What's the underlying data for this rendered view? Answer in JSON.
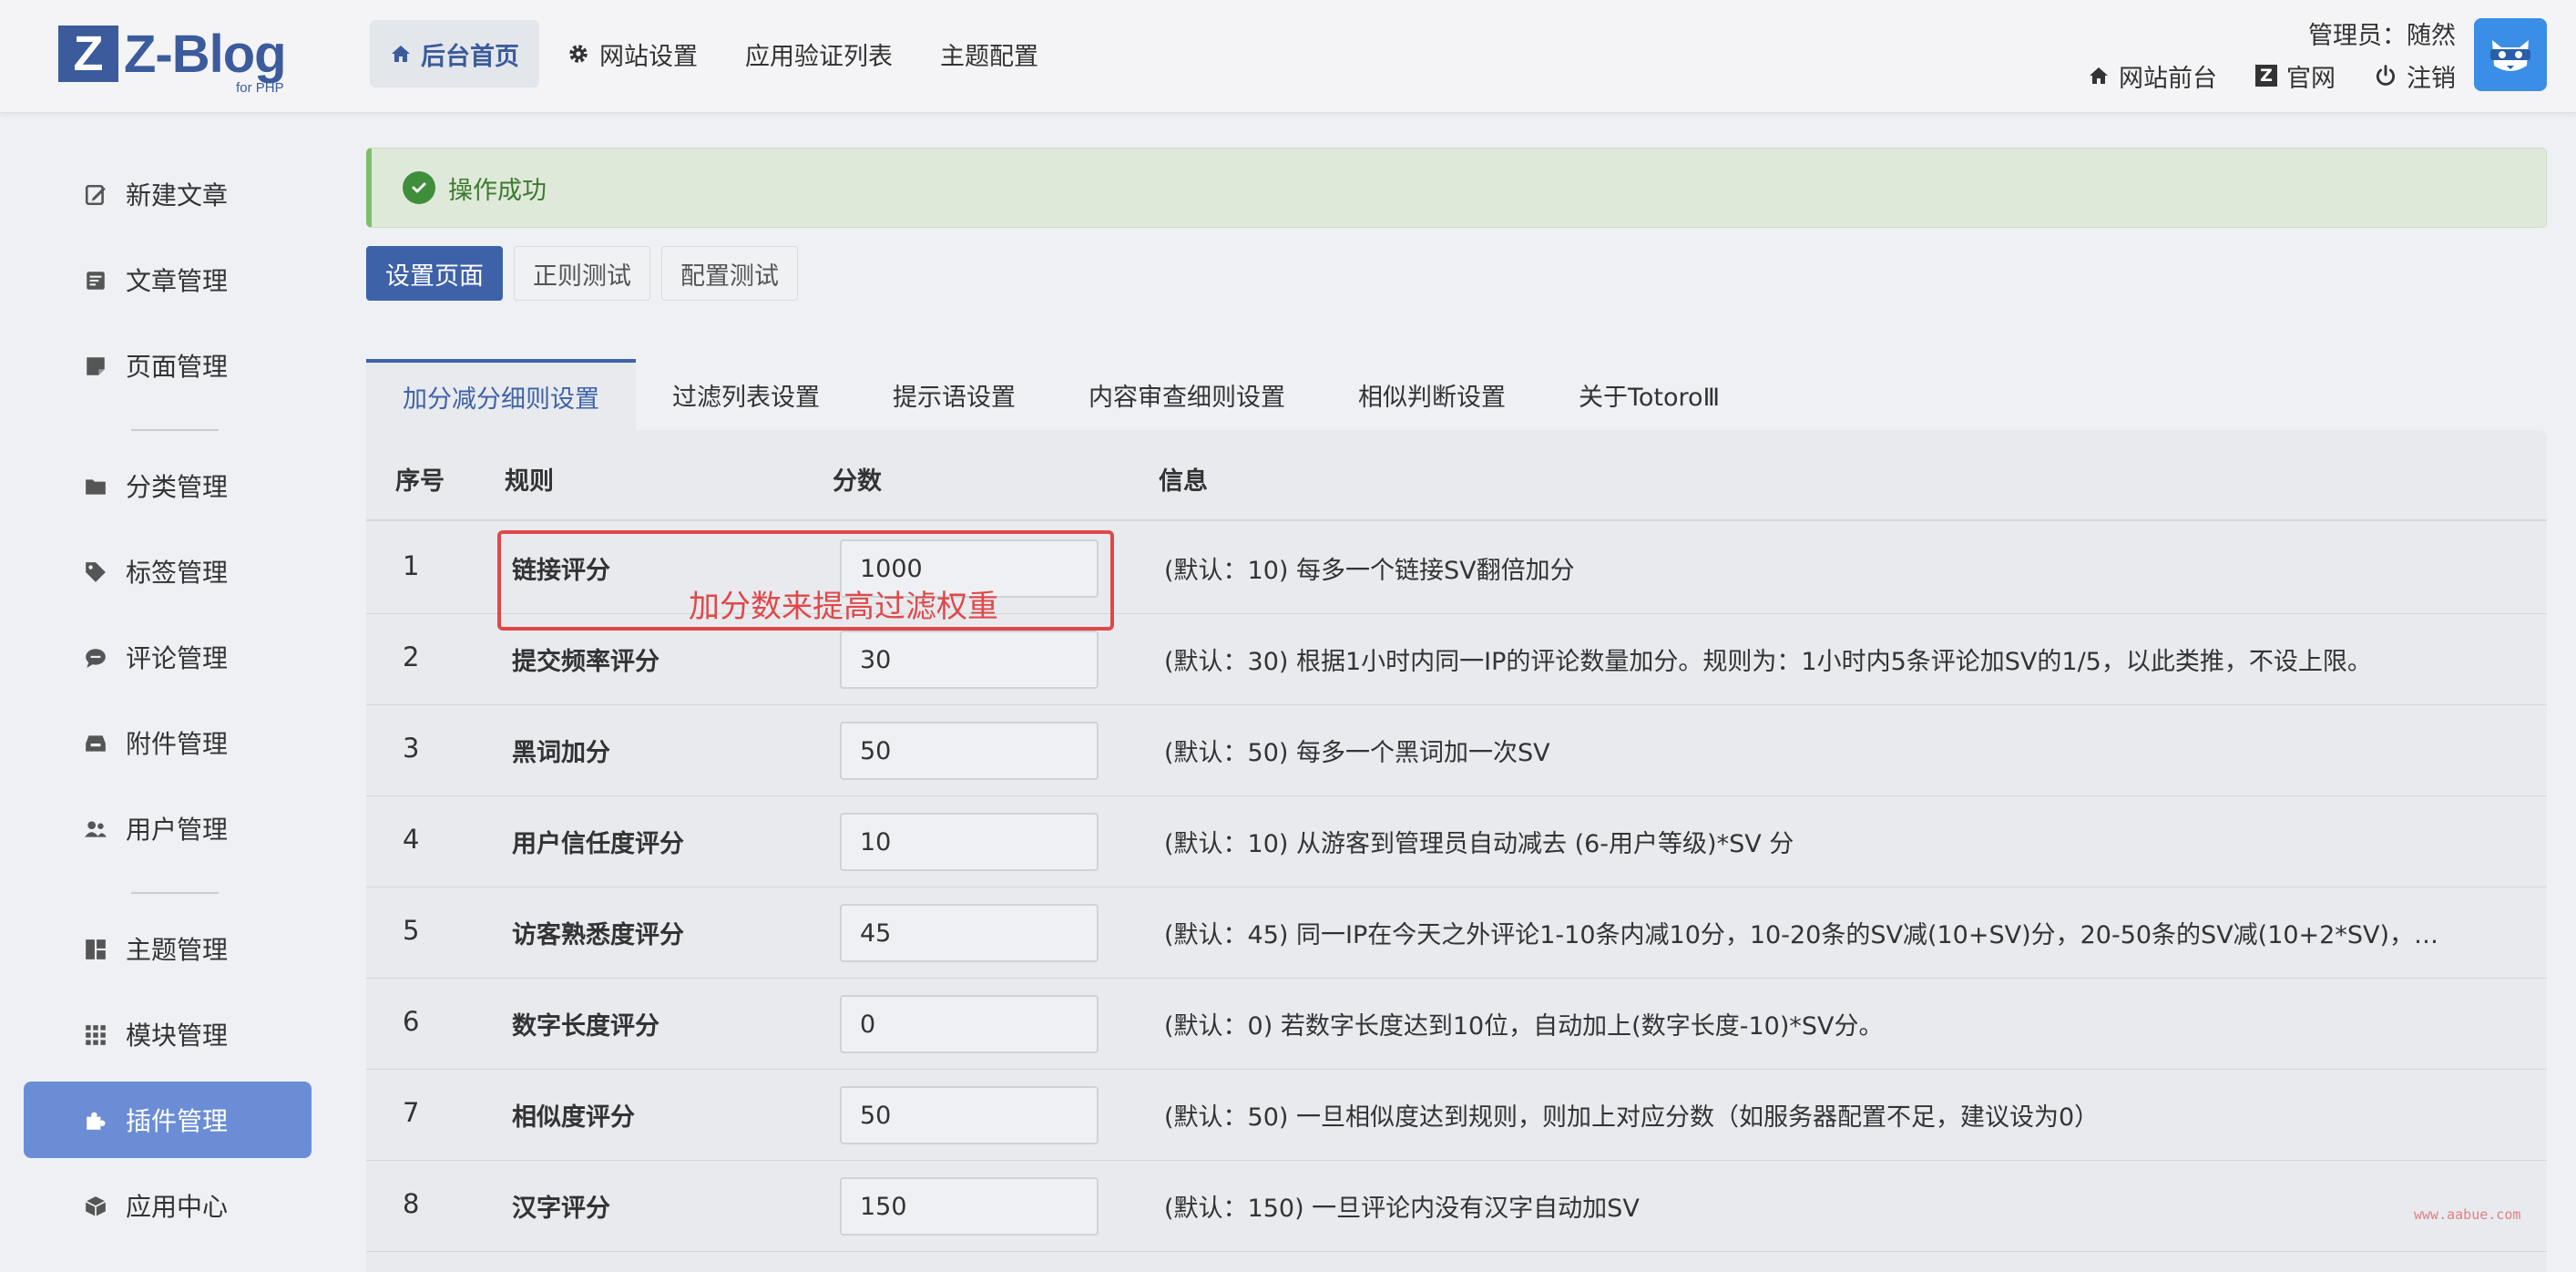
{
  "logo": {
    "letter": "Z",
    "name": "Z-Blog",
    "sub": "for PHP"
  },
  "topnav": [
    {
      "label": "后台首页",
      "icon": "home-icon",
      "active": true
    },
    {
      "label": "网站设置",
      "icon": "gear-icon",
      "active": false
    },
    {
      "label": "应用验证列表",
      "active": false
    },
    {
      "label": "主题配置",
      "active": false
    }
  ],
  "admin": {
    "label": "管理员：随然",
    "links": [
      {
        "label": "网站前台",
        "icon": "home-icon"
      },
      {
        "label": "官网",
        "icon": "zblog-icon"
      },
      {
        "label": "注销",
        "icon": "power-icon"
      }
    ]
  },
  "sidebar": {
    "items": [
      {
        "label": "新建文章",
        "icon": "edit-icon"
      },
      {
        "label": "文章管理",
        "icon": "article-icon"
      },
      {
        "label": "页面管理",
        "icon": "page-icon"
      },
      {
        "label": "分类管理",
        "icon": "folder-icon"
      },
      {
        "label": "标签管理",
        "icon": "tag-icon"
      },
      {
        "label": "评论管理",
        "icon": "comment-icon"
      },
      {
        "label": "附件管理",
        "icon": "attachment-icon"
      },
      {
        "label": "用户管理",
        "icon": "users-icon"
      },
      {
        "label": "主题管理",
        "icon": "theme-icon"
      },
      {
        "label": "模块管理",
        "icon": "grid-icon"
      },
      {
        "label": "插件管理",
        "icon": "puzzle-icon",
        "active": true
      },
      {
        "label": "应用中心",
        "icon": "box-icon"
      }
    ]
  },
  "alert": {
    "text": "操作成功"
  },
  "page_buttons": [
    {
      "label": "设置页面",
      "primary": true
    },
    {
      "label": "正则测试",
      "primary": false
    },
    {
      "label": "配置测试",
      "primary": false
    }
  ],
  "tabs": [
    {
      "label": "加分减分细则设置",
      "active": true
    },
    {
      "label": "过滤列表设置"
    },
    {
      "label": "提示语设置"
    },
    {
      "label": "内容审查细则设置"
    },
    {
      "label": "相似判断设置"
    },
    {
      "label": "关于TotoroⅢ"
    }
  ],
  "table": {
    "headers": {
      "no": "序号",
      "rule": "规则",
      "score": "分数",
      "info": "信息"
    },
    "rows": [
      {
        "no": "1",
        "rule": "链接评分",
        "score": "1000",
        "info": "(默认：10) 每多一个链接SV翻倍加分"
      },
      {
        "no": "2",
        "rule": "提交频率评分",
        "score": "30",
        "info": "(默认：30) 根据1小时内同一IP的评论数量加分。规则为：1小时内5条评论加SV的1/5，以此类推，不设上限。"
      },
      {
        "no": "3",
        "rule": "黑词加分",
        "score": "50",
        "info": "(默认：50) 每多一个黑词加一次SV"
      },
      {
        "no": "4",
        "rule": "用户信任度评分",
        "score": "10",
        "info": "(默认：10) 从游客到管理员自动减去 (6-用户等级)*SV 分"
      },
      {
        "no": "5",
        "rule": "访客熟悉度评分",
        "score": "45",
        "info": "(默认：45) 同一IP在今天之外评论1-10条内减10分，10-20条的SV减(10+SV)分，20-50条的SV减(10+2*SV)，…"
      },
      {
        "no": "6",
        "rule": "数字长度评分",
        "score": "0",
        "info": "(默认：0) 若数字长度达到10位，自动加上(数字长度-10)*SV分。"
      },
      {
        "no": "7",
        "rule": "相似度评分",
        "score": "50",
        "info": "(默认：50) 一旦相似度达到规则，则加上对应分数（如服务器配置不足，建议设为0）"
      },
      {
        "no": "8",
        "rule": "汉字评分",
        "score": "150",
        "info": "(默认：150) 一旦评论内没有汉字自动加SV"
      }
    ]
  },
  "annotation": {
    "text": "加分数来提高过滤权重",
    "color": "#e04848"
  },
  "watermark": "www.aabue.com",
  "colors": {
    "primary": "#3e62a8",
    "sidebar_active": "#6b8dd6",
    "success": "#3f8e3b"
  }
}
